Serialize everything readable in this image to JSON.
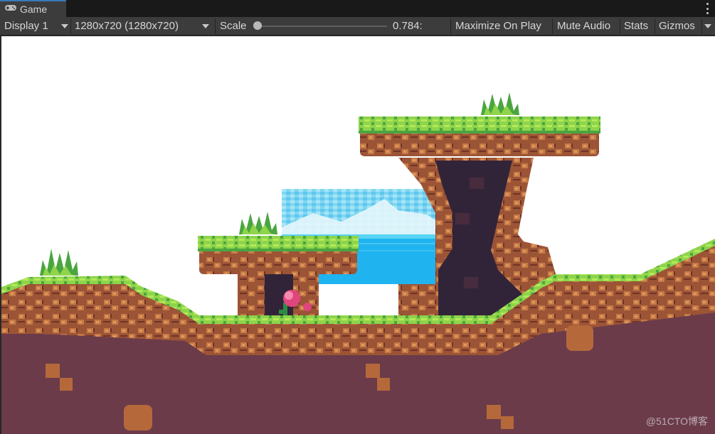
{
  "tab": {
    "title": "Game",
    "icon": "gamepad-icon"
  },
  "toolbar": {
    "display_label": "Display 1",
    "resolution_label": "1280x720 (1280x720)",
    "scale_label": "Scale",
    "scale_value": "0.784:",
    "scale_slider": 0.0,
    "maximize_label": "Maximize On Play",
    "mute_label": "Mute Audio",
    "stats_label": "Stats",
    "gizmos_label": "Gizmos"
  },
  "watermark": "@51CTO博客",
  "colors": {
    "tab_bg": "#3c3c3c",
    "tab_accent": "#3a79bb",
    "toolbar_bg": "#3c3c3c",
    "grass": "#8fd44a",
    "dirt": "#b5693a",
    "underground": "#6b3b4a",
    "sky_panel": "#2bbcf2"
  }
}
